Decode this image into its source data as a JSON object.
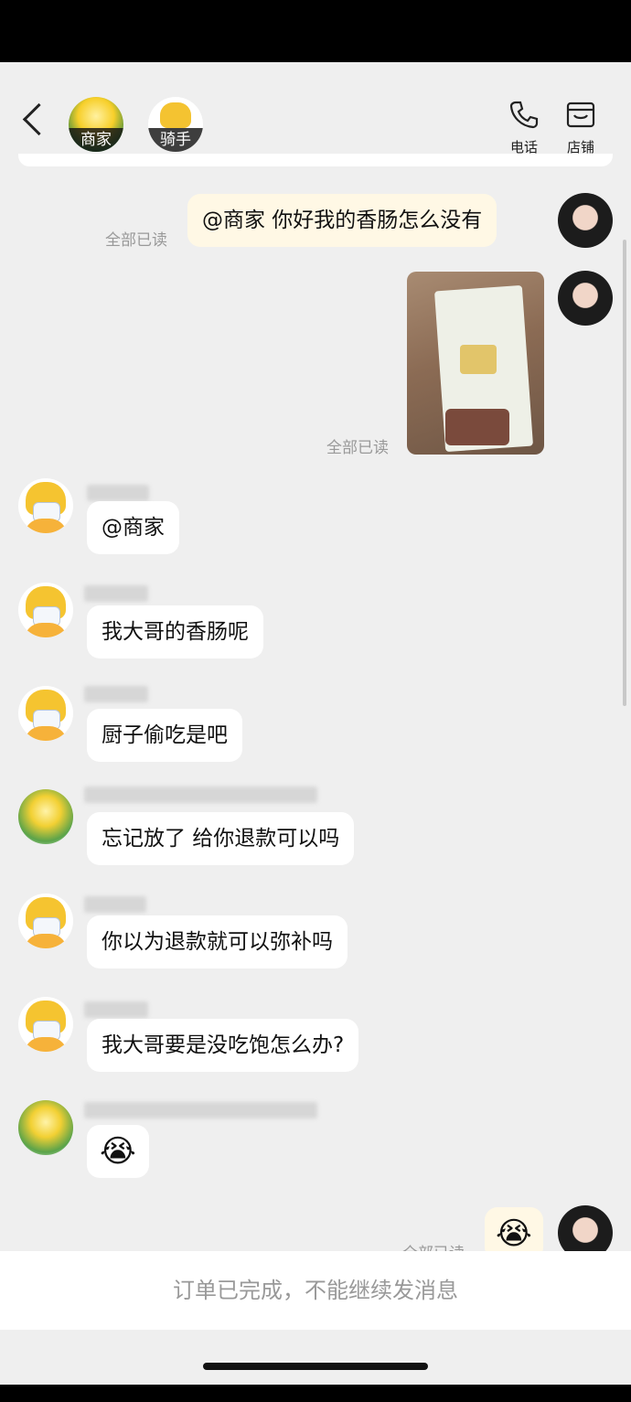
{
  "header": {
    "merchant_label": "商家",
    "rider_label": "骑手",
    "phone_label": "电话",
    "store_label": "店铺"
  },
  "messages": [
    {
      "side": "right",
      "text": "@商家 你好我的香肠怎么没有",
      "read": "全部已读"
    },
    {
      "side": "right",
      "type": "image",
      "read": "全部已读"
    },
    {
      "side": "left",
      "text": "@商家"
    },
    {
      "side": "left",
      "text": "我大哥的香肠呢"
    },
    {
      "side": "left",
      "text": "厨子偷吃是吧"
    },
    {
      "side": "left",
      "text": "忘记放了 给你退款可以吗"
    },
    {
      "side": "left",
      "text": "你以为退款就可以弥补吗"
    },
    {
      "side": "left",
      "text": "我大哥要是没吃饱怎么办?"
    },
    {
      "side": "left",
      "emoji": "😭"
    },
    {
      "side": "right",
      "emoji": "😭",
      "read": "全部已读"
    }
  ],
  "footer": {
    "notice": "订单已完成，不能继续发消息"
  },
  "colors": {
    "background": "#efefef",
    "bubble_mine": "#fff8e5",
    "bubble_other": "#ffffff"
  }
}
